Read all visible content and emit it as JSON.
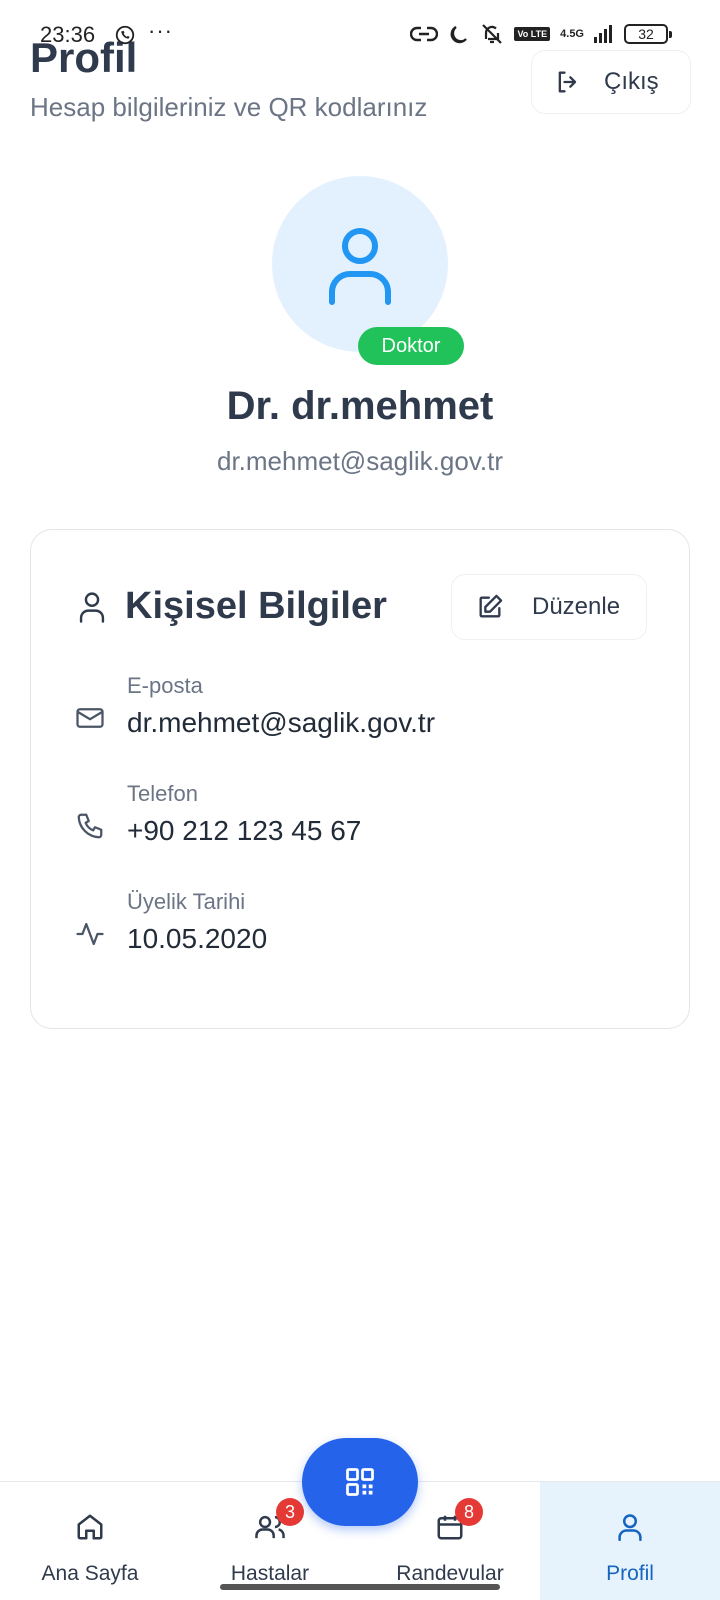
{
  "status_bar": {
    "time": "23:36",
    "more": "···",
    "network": "4.5G",
    "lte": "Vo LTE",
    "battery": "32"
  },
  "header": {
    "title": "Profil",
    "subtitle": "Hesap bilgileriniz ve QR kodlarınız",
    "logout_label": "Çıkış"
  },
  "profile": {
    "role": "Doktor",
    "name": "Dr. dr.mehmet",
    "email": "dr.mehmet@saglik.gov.tr"
  },
  "personal_info": {
    "title": "Kişisel Bilgiler",
    "edit_label": "Düzenle",
    "fields": [
      {
        "label": "E-posta",
        "value": "dr.mehmet@saglik.gov.tr",
        "icon": "mail-icon"
      },
      {
        "label": "Telefon",
        "value": "+90 212 123 45 67",
        "icon": "phone-icon"
      },
      {
        "label": "Üyelik Tarihi",
        "value": "10.05.2020",
        "icon": "activity-icon"
      }
    ]
  },
  "bottom_nav": {
    "items": [
      {
        "label": "Ana Sayfa",
        "icon": "home-icon"
      },
      {
        "label": "Hastalar",
        "icon": "users-icon",
        "badge": "3"
      },
      {
        "label": "Randevular",
        "icon": "calendar-icon",
        "badge": "8"
      },
      {
        "label": "Profil",
        "icon": "user-icon",
        "active": true
      }
    ],
    "fab_icon": "qr-code-icon"
  },
  "colors": {
    "primary": "#2563eb",
    "badge_green": "#21c25a",
    "badge_red": "#e53935",
    "avatar_bg": "#e3f0fd",
    "avatar_icon": "#2196f3",
    "active_tab_bg": "#e6f3fd",
    "active_tab_text": "#1565c0"
  }
}
